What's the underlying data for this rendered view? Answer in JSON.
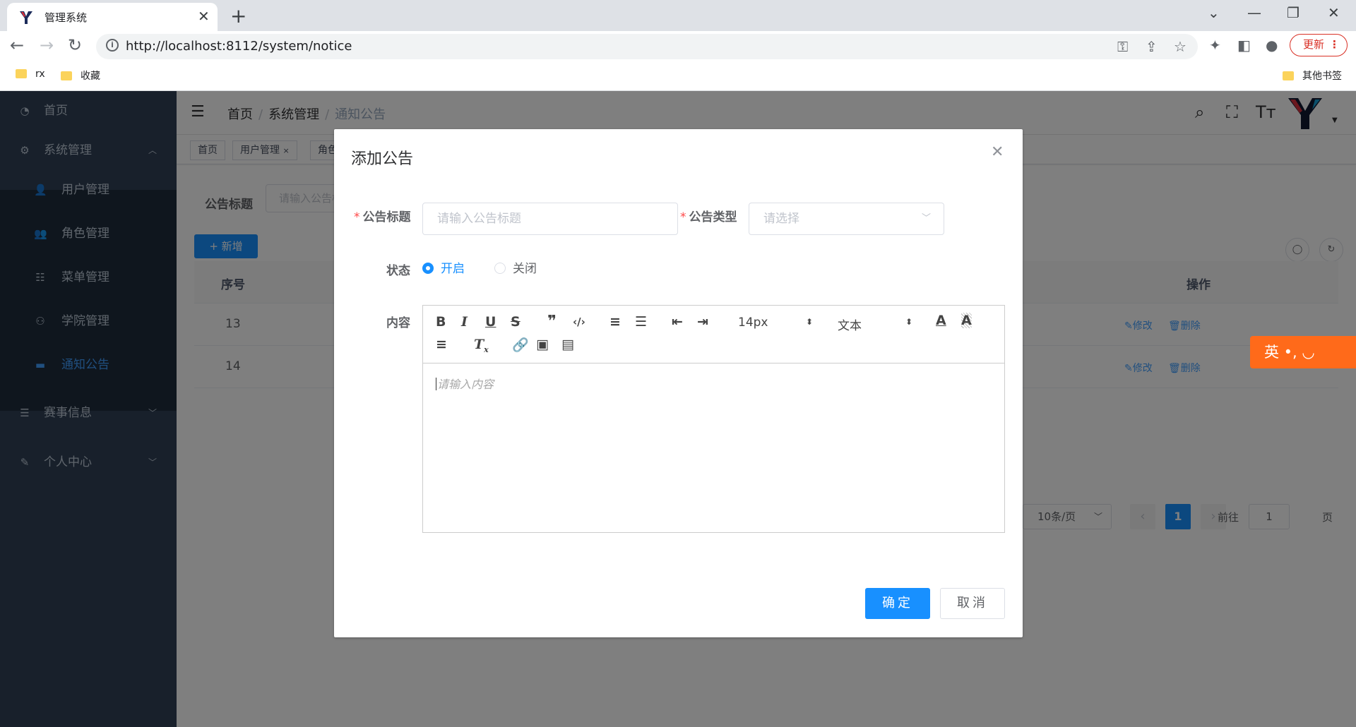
{
  "browser": {
    "tab_title": "管理系统",
    "url": "http://localhost:8112/system/notice",
    "update_label": "更新",
    "bookmarks": [
      "rx",
      "收藏"
    ],
    "other_bookmarks": "其他书签"
  },
  "sidebar": {
    "home": "首页",
    "system": "系统管理",
    "sub": [
      "用户管理",
      "角色管理",
      "菜单管理",
      "学院管理",
      "通知公告"
    ],
    "events": "赛事信息",
    "profile": "个人中心"
  },
  "navbar": {
    "breadcrumb": [
      "首页",
      "系统管理",
      "通知公告"
    ]
  },
  "tags": [
    "首页",
    "用户管理",
    "角色"
  ],
  "query": {
    "title_label": "公告标题",
    "title_placeholder": "请输入公告标题"
  },
  "toolbar": {
    "add_label": "+ 新增"
  },
  "table": {
    "headers": {
      "index": "序号",
      "actions": "操作"
    },
    "rows": [
      {
        "index": "13",
        "edit": "修改",
        "delete": "删除"
      },
      {
        "index": "14",
        "edit": "修改",
        "delete": "删除"
      }
    ]
  },
  "pagination": {
    "page_size": "10条/页",
    "current_page": "1",
    "goto_label": "前往",
    "goto_value": "1",
    "page_unit": "页"
  },
  "ime": {
    "label": "英 •, ◡"
  },
  "dialog": {
    "title": "添加公告",
    "notice_title_label": "公告标题",
    "notice_title_placeholder": "请输入公告标题",
    "notice_type_label": "公告类型",
    "notice_type_placeholder": "请选择",
    "status_label": "状态",
    "status_open": "开启",
    "status_closed": "关闭",
    "content_label": "内容",
    "editor": {
      "font_size": "14px",
      "block_format": "文本",
      "placeholder": "请输入内容"
    },
    "ok_label": "确定",
    "cancel_label": "取消"
  },
  "colors": {
    "primary": "#1890ff",
    "sidebar": "#304156",
    "sidebar_sub": "#1f2d3d",
    "danger": "#ff4949",
    "ime": "#ff6a1a"
  }
}
